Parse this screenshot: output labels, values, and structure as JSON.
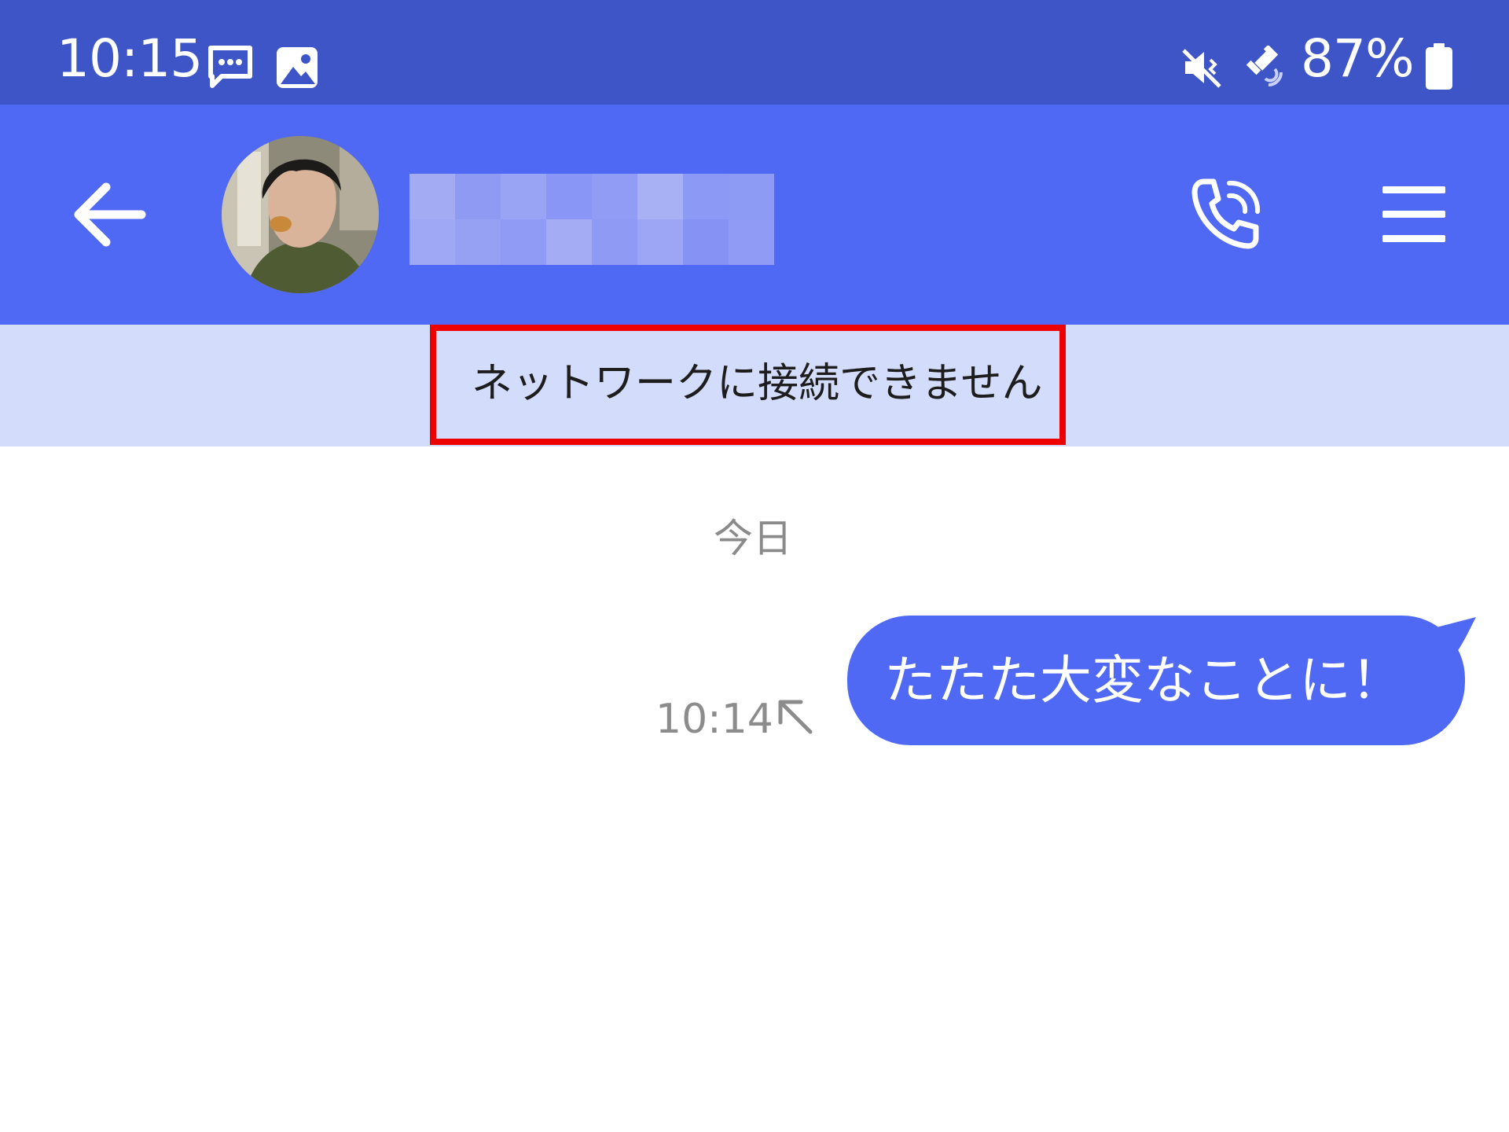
{
  "status_bar": {
    "time": "10:15",
    "battery_percent": "87%",
    "icons": [
      "message-icon",
      "image-icon",
      "vibrate-mute-icon",
      "satellite-icon",
      "battery-icon"
    ]
  },
  "header": {
    "back_icon": "arrow-left-icon",
    "call_icon": "phone-call-icon",
    "menu_icon": "hamburger-menu-icon",
    "name_blurred": true
  },
  "banner": {
    "text": "ネットワークに接続できません",
    "highlight_color": "#ee0000"
  },
  "chat": {
    "date_label": "今日",
    "messages": [
      {
        "text": "たたた大変なことに！",
        "time": "10:14",
        "status_icon": "arrow-up-left-icon",
        "outgoing": true
      }
    ]
  },
  "colors": {
    "status_bar": "#3d55c7",
    "accent": "#5069f5",
    "banner_bg": "#d3dcfb",
    "meta_text": "#8c8c8c"
  }
}
